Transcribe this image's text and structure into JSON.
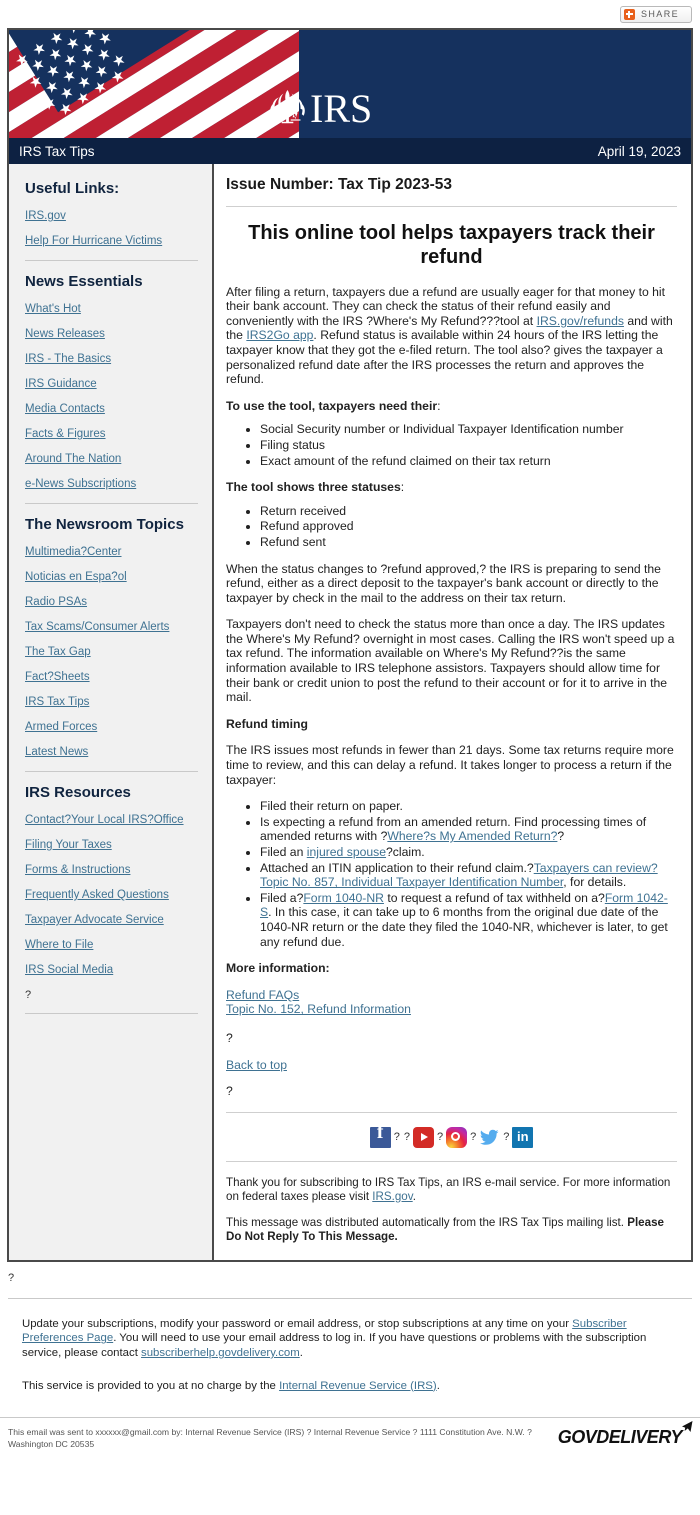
{
  "share": {
    "label": "SHARE",
    "icon": "plus-square-icon",
    "accent": "#e8601c"
  },
  "masthead": {
    "logo_text": "IRS",
    "seal_icon": "irs-eagle-scales-seal",
    "flag_icon": "us-flag-banner",
    "bg_color": "#15315e"
  },
  "titlebar": {
    "title": "IRS Tax Tips",
    "date": "April 19, 2023",
    "bg_color": "#0d2142"
  },
  "sidebar": {
    "sections": [
      {
        "heading": "Useful Links:",
        "links": [
          "IRS.gov",
          "Help For Hurricane Victims"
        ]
      },
      {
        "heading": "News Essentials",
        "links": [
          "What's Hot",
          "News Releases",
          "IRS - The Basics",
          "IRS Guidance",
          "Media Contacts",
          "Facts & Figures",
          "Around The Nation",
          "e-News Subscriptions"
        ]
      },
      {
        "heading": "The Newsroom Topics",
        "links": [
          "Multimedia?Center",
          "Noticias en Espa?ol",
          "Radio PSAs",
          "Tax Scams/Consumer Alerts",
          "The Tax Gap",
          "Fact?Sheets",
          "IRS Tax Tips",
          "Armed Forces",
          "Latest News"
        ]
      },
      {
        "heading": "IRS Resources",
        "links": [
          "Contact?Your Local IRS?Office",
          "Filing Your Taxes",
          "Forms & Instructions",
          "Frequently Asked Questions",
          "Taxpayer Advocate Service",
          "Where to File",
          "IRS Social Media"
        ],
        "trailing_text": "?"
      }
    ]
  },
  "article": {
    "issue_number": "Issue Number: Tax Tip 2023-53",
    "headline": "This online tool helps taxpayers track their refund",
    "intro": {
      "part1": "After filing a return, taxpayers due a refund are usually eager for that money to hit their bank account. They can check the status of their refund easily and conveniently with the IRS ?Where's My Refund???tool at ",
      "link1": "IRS.gov/refunds",
      "part2": " and with the ",
      "link2": "IRS2Go app",
      "part3": ". Refund status is available within 24 hours of the IRS letting the taxpayer know that they got the e-filed return. The tool also? gives the taxpayer a personalized refund date after the IRS processes the return and approves the refund."
    },
    "need_heading_bold": "To use the tool, taxpayers need their",
    "need_heading_tail": ":",
    "need_items": [
      "Social Security number or Individual Taxpayer Identification number",
      "Filing status",
      "Exact amount of the refund claimed on their tax return"
    ],
    "statuses_heading_bold": "The tool shows three statuses",
    "statuses_heading_tail": ":",
    "statuses_items": [
      "Return received",
      "Refund approved",
      "Refund sent"
    ],
    "status_change_para": "When the status changes to ?refund approved,? the IRS is preparing to send the refund, either as a direct deposit to the taxpayer's bank account or directly to the taxpayer by check in the mail to the address on their tax return.",
    "once_a_day_para": "Taxpayers don't need to check the status more than once a day. The IRS updates the Where's My Refund? overnight in most cases. Calling the IRS won't speed up a tax refund. The information available on Where's My Refund??is the same information available to IRS telephone assistors. Taxpayers should allow time for their bank or credit union to post the refund to their account or for it to arrive in the mail.",
    "refund_timing_heading": "Refund timing",
    "refund_timing_para": "The IRS issues most refunds in fewer than 21 days. Some tax returns require more time to review, and this can delay a refund. It takes longer to process a return if the taxpayer:",
    "timing_items": {
      "item1": "Filed their return on paper.",
      "item2_part1": "Is expecting a refund from an amended return. Find processing times of amended returns with ?",
      "item2_link": "Where?s My Amended Return?",
      "item2_part2": "?",
      "item3_part1": "Filed an ",
      "item3_link": "injured spouse",
      "item3_part2": "?claim.",
      "item4_part1": "Attached an ITIN application to their refund claim.?",
      "item4_link": "Taxpayers can review?Topic No. 857, Individual Taxpayer Identification Number",
      "item4_part2": ", for details.",
      "item5_part1": "Filed a?",
      "item5_link1": "Form 1040-NR",
      "item5_part2": " to request a refund of tax withheld on a?",
      "item5_link2": "Form 1042-S",
      "item5_part3": ". In this case, it can take up to 6 months from the original due date of the 1040-NR return or the date they filed the 1040-NR, whichever is later, to get any refund due."
    },
    "more_info_heading": "More information:",
    "more_info_links": [
      "Refund FAQs",
      "Topic No. 152, Refund Information"
    ],
    "spacer_q1": "?",
    "back_to_top": "Back to top",
    "spacer_q2": "?"
  },
  "social": {
    "separator": "?",
    "icons": [
      {
        "name": "facebook-icon",
        "label": "Facebook",
        "color": "#3b5998"
      },
      {
        "name": "youtube-icon",
        "label": "YouTube",
        "color": "#d32b26"
      },
      {
        "name": "instagram-icon",
        "label": "Instagram",
        "color": "#c32aa3"
      },
      {
        "name": "twitter-icon",
        "label": "Twitter",
        "color": "#55acee"
      },
      {
        "name": "linkedin-icon",
        "label": "LinkedIn",
        "color": "#1175b0"
      }
    ]
  },
  "thanks": {
    "part1": "Thank you for subscribing to IRS Tax Tips, an IRS e-mail service. For more information on federal taxes please visit ",
    "link": "IRS.gov",
    "part2": ".",
    "distributed_part1": "This message was distributed automatically from the IRS Tax Tips mailing list. ",
    "distributed_bold": "Please Do Not Reply To This Message."
  },
  "outer": {
    "spacer_q": "?",
    "subscriptions_part1": "Update your subscriptions, modify your password or email address, or stop subscriptions at any time on your ",
    "subscriptions_link1": "Subscriber Preferences Page",
    "subscriptions_part2": ". You will need to use your email address to log in. If you have questions or problems with the subscription service, please contact ",
    "subscriptions_link2": "subscriberhelp.govdelivery.com",
    "subscriptions_part3": ".",
    "service_part1": "This service is provided to you at no charge by the ",
    "service_link": "Internal Revenue Service (IRS)",
    "service_part2": "."
  },
  "footer": {
    "sent_text": "This email was sent to xxxxxx@gmail.com by: Internal Revenue Service (IRS) ? Internal Revenue Service ? 1111 Constitution Ave. N.W. ? Washington DC 20535",
    "brand": "govdelivery",
    "brand_display": "GOVDELIVERY"
  }
}
